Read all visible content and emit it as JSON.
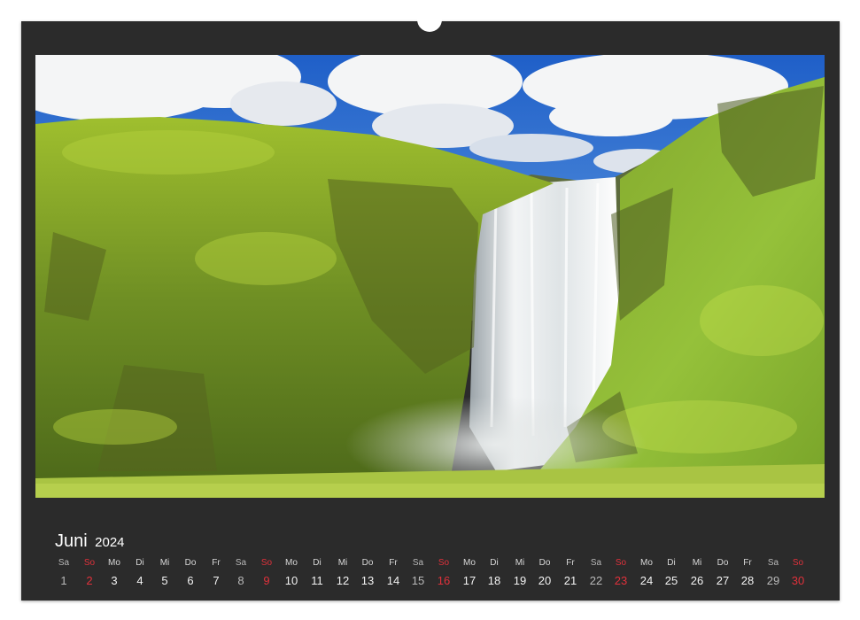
{
  "calendar": {
    "month": "Juni",
    "year": "2024",
    "days": [
      {
        "name": "Sa",
        "num": "1",
        "type": "sat"
      },
      {
        "name": "So",
        "num": "2",
        "type": "sun"
      },
      {
        "name": "Mo",
        "num": "3",
        "type": "week"
      },
      {
        "name": "Di",
        "num": "4",
        "type": "week"
      },
      {
        "name": "Mi",
        "num": "5",
        "type": "week"
      },
      {
        "name": "Do",
        "num": "6",
        "type": "week"
      },
      {
        "name": "Fr",
        "num": "7",
        "type": "week"
      },
      {
        "name": "Sa",
        "num": "8",
        "type": "sat"
      },
      {
        "name": "So",
        "num": "9",
        "type": "sun"
      },
      {
        "name": "Mo",
        "num": "10",
        "type": "week"
      },
      {
        "name": "Di",
        "num": "11",
        "type": "week"
      },
      {
        "name": "Mi",
        "num": "12",
        "type": "week"
      },
      {
        "name": "Do",
        "num": "13",
        "type": "week"
      },
      {
        "name": "Fr",
        "num": "14",
        "type": "week"
      },
      {
        "name": "Sa",
        "num": "15",
        "type": "sat"
      },
      {
        "name": "So",
        "num": "16",
        "type": "sun"
      },
      {
        "name": "Mo",
        "num": "17",
        "type": "week"
      },
      {
        "name": "Di",
        "num": "18",
        "type": "week"
      },
      {
        "name": "Mi",
        "num": "19",
        "type": "week"
      },
      {
        "name": "Do",
        "num": "20",
        "type": "week"
      },
      {
        "name": "Fr",
        "num": "21",
        "type": "week"
      },
      {
        "name": "Sa",
        "num": "22",
        "type": "sat"
      },
      {
        "name": "So",
        "num": "23",
        "type": "sun"
      },
      {
        "name": "Mo",
        "num": "24",
        "type": "week"
      },
      {
        "name": "Di",
        "num": "25",
        "type": "week"
      },
      {
        "name": "Mi",
        "num": "26",
        "type": "week"
      },
      {
        "name": "Do",
        "num": "27",
        "type": "week"
      },
      {
        "name": "Fr",
        "num": "28",
        "type": "week"
      },
      {
        "name": "Sa",
        "num": "29",
        "type": "sat"
      },
      {
        "name": "So",
        "num": "30",
        "type": "sun"
      }
    ]
  },
  "colors": {
    "sheet": "#2b2b2b",
    "sunday": "#e0313b",
    "text": "#f2f2f2"
  },
  "photo": {
    "subject": "waterfall-landscape"
  }
}
